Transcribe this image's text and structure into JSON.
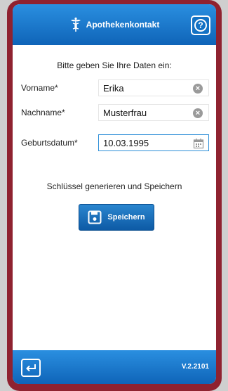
{
  "header": {
    "title": "Apothekenkontakt",
    "logo_icon": "caduceus-icon",
    "help_icon": "help-circle-icon",
    "help_glyph": "?"
  },
  "form": {
    "instruction": "Bitte geben Sie Ihre Daten ein:",
    "fields": [
      {
        "label": "Vorname*",
        "value": "Erika",
        "action_icon": "clear-icon"
      },
      {
        "label": "Nachname*",
        "value": "Musterfrau",
        "action_icon": "clear-icon"
      },
      {
        "label": "Geburtsdatum*",
        "value": "10.03.1995",
        "action_icon": "calendar-icon"
      }
    ]
  },
  "actions": {
    "generate_text": "Schlüssel generieren und Speichern",
    "save_label": "Speichern",
    "save_icon": "floppy-disk-icon"
  },
  "footer": {
    "back_icon": "back-arrow-icon",
    "version": "V.2.2101"
  },
  "colors": {
    "primary_blue": "#0f64b8",
    "frame_red": "#8f2230",
    "focus_border": "#2e8fd8"
  }
}
